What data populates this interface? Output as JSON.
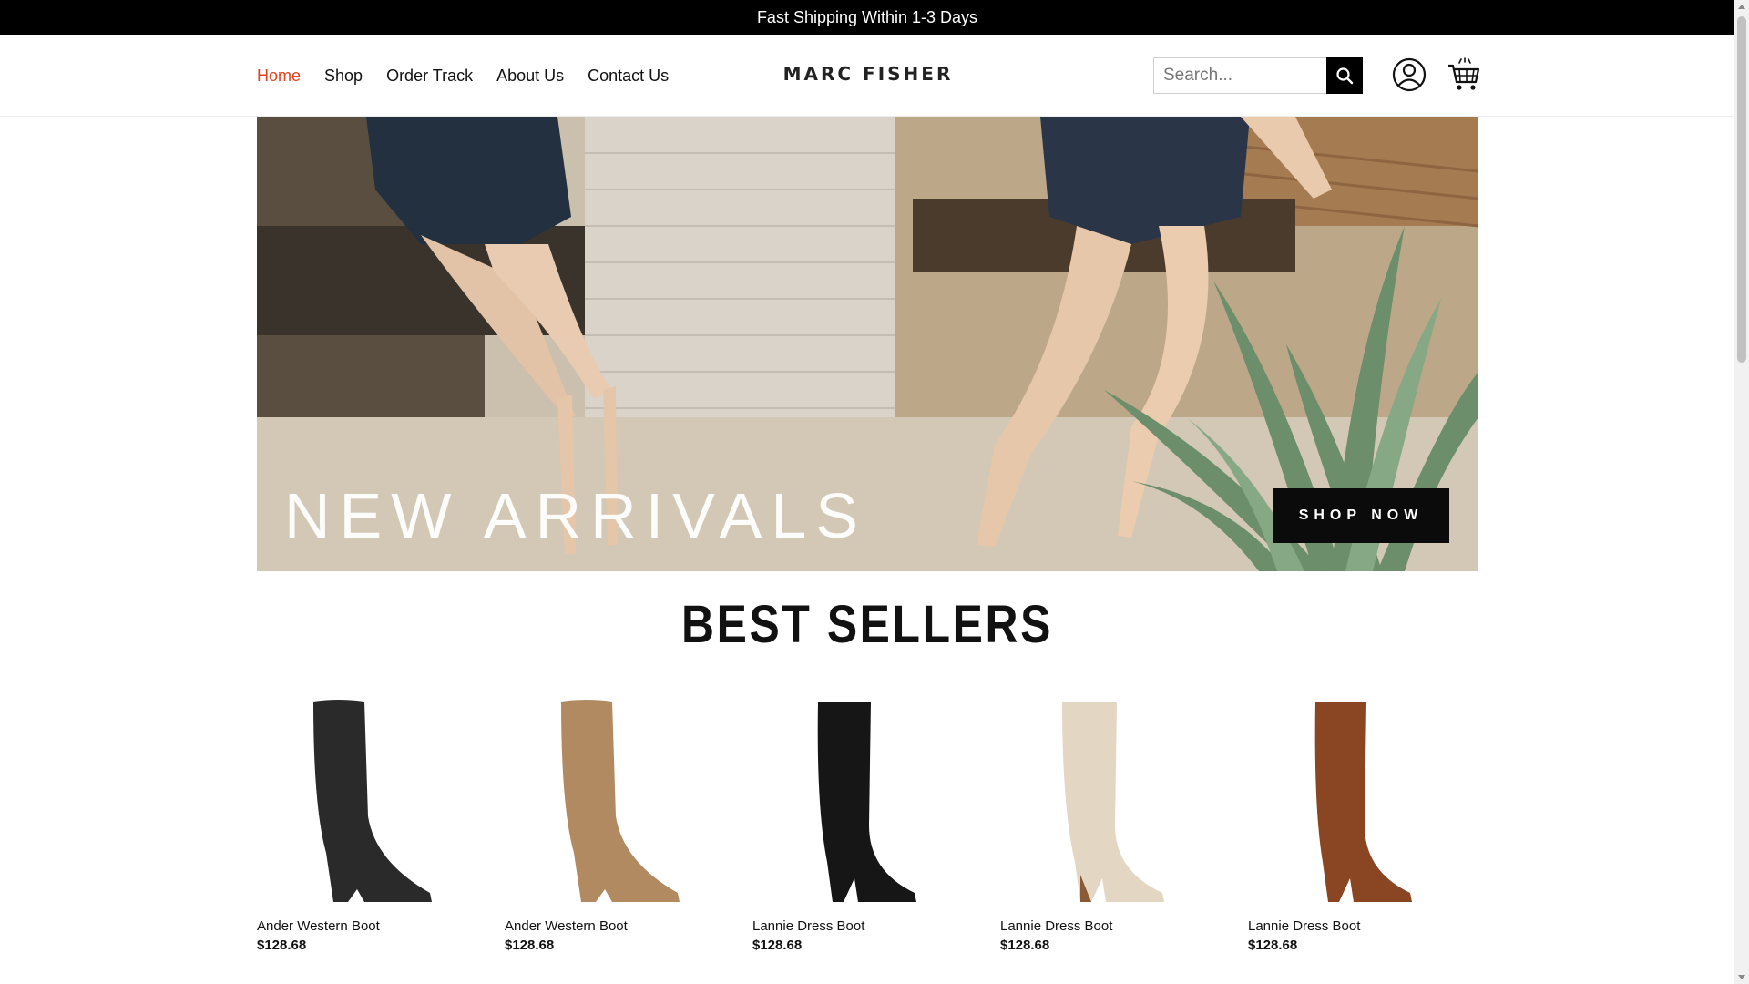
{
  "announcement": "Fast Shipping Within 1-3 Days",
  "nav": {
    "items": [
      {
        "label": "Home",
        "active": true
      },
      {
        "label": "Shop",
        "active": false
      },
      {
        "label": "Order Track",
        "active": false
      },
      {
        "label": "About Us",
        "active": false
      },
      {
        "label": "Contact Us",
        "active": false
      }
    ],
    "active_color": "#e0431b"
  },
  "brand": {
    "logo_text": "MARC FISHER"
  },
  "search": {
    "placeholder": "Search...",
    "value": "",
    "icon": "search-icon"
  },
  "header_icons": {
    "account": "user-icon",
    "cart": "cart-icon"
  },
  "hero": {
    "title": "NEW ARRIVALS",
    "cta": "SHOP NOW"
  },
  "best_sellers": {
    "title": "BEST SELLERS",
    "products": [
      {
        "name": "Ander Western Boot",
        "price": "$128.68",
        "color": "#2a2a2a",
        "style": "western"
      },
      {
        "name": "Ander Western Boot",
        "price": "$128.68",
        "color": "#b18a62",
        "style": "western"
      },
      {
        "name": "Lannie Dress Boot",
        "price": "$128.68",
        "color": "#161616",
        "style": "dress"
      },
      {
        "name": "Lannie Dress Boot",
        "price": "$128.68",
        "color": "#e3d6c2",
        "style": "dress"
      },
      {
        "name": "Lannie Dress Boot",
        "price": "$128.68",
        "color": "#8a4523",
        "style": "dress"
      }
    ]
  }
}
